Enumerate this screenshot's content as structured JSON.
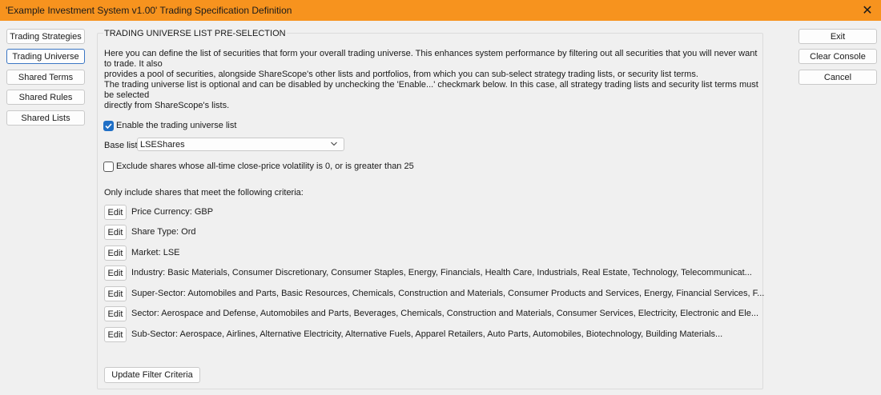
{
  "window": {
    "title": "'Example Investment System v1.00' Trading Specification Definition",
    "close_glyph": "✕"
  },
  "nav": {
    "items": [
      {
        "label": "Trading Strategies"
      },
      {
        "label": "Trading Universe"
      },
      {
        "label": "Shared Terms"
      },
      {
        "label": "Shared Rules"
      },
      {
        "label": "Shared Lists"
      }
    ],
    "active_index": 1
  },
  "actions": {
    "exit": "Exit",
    "clear_console": "Clear Console",
    "cancel": "Cancel"
  },
  "panel": {
    "title": "TRADING UNIVERSE LIST PRE-SELECTION",
    "intro_1_line_1": "Here you can define the list of securities that form your overall trading universe. This enhances system performance by filtering out all securities that you will never want to trade. It also",
    "intro_1_line_2": "provides a pool of securities, alongside ShareScope's other lists and portfolios, from which you can sub-select strategy trading lists, or security list terms.",
    "intro_2_line_1": "The trading universe list is optional and can be disabled by unchecking the 'Enable...' checkmark below. In this case, all strategy trading lists and security list terms must be selected",
    "intro_2_line_2": "directly from ShareScope's lists.",
    "enable_label": "Enable the trading universe list",
    "enable_checked": true,
    "base_list_label": "Base list:",
    "base_list_value": "LSEShares",
    "exclude_label": "Exclude shares whose all-time close-price volatility is 0, or is greater than 25",
    "exclude_checked": false,
    "criteria_heading": "Only include shares that meet the following criteria:",
    "edit_label": "Edit",
    "criteria": [
      "Price Currency: GBP",
      "Share Type: Ord",
      "Market: LSE",
      "Industry: Basic Materials, Consumer Discretionary, Consumer Staples, Energy, Financials, Health Care, Industrials, Real Estate, Technology, Telecommunicat...",
      "Super-Sector: Automobiles and Parts, Basic Resources, Chemicals, Construction and Materials, Consumer Products and Services, Energy, Financial Services, F...",
      "Sector: Aerospace and Defense, Automobiles and Parts, Beverages, Chemicals, Construction and Materials, Consumer Services, Electricity, Electronic and Ele...",
      "Sub-Sector: Aerospace, Airlines, Alternative Electricity, Alternative Fuels, Apparel Retailers, Auto Parts, Automobiles, Biotechnology, Building Materials..."
    ],
    "update_button": "Update Filter Criteria"
  },
  "colors": {
    "titlebar": "#f7931e",
    "active_border": "#3b76c4",
    "checkbox_on": "#1f6fc6"
  }
}
